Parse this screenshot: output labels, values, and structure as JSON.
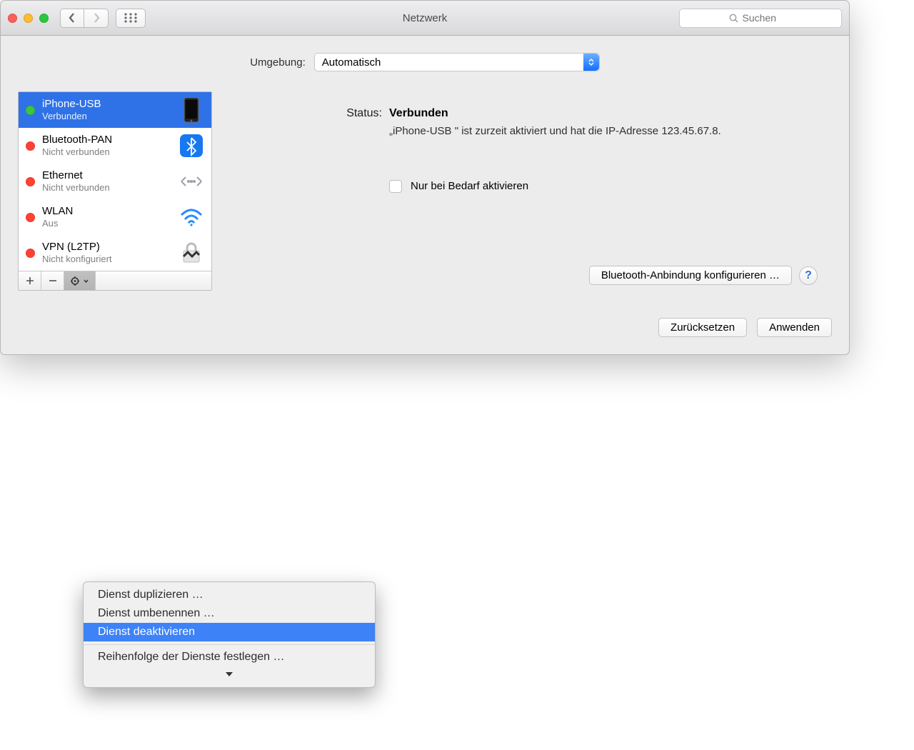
{
  "window": {
    "title": "Netzwerk"
  },
  "search": {
    "placeholder": "Suchen"
  },
  "location": {
    "label": "Umgebung:",
    "value": "Automatisch"
  },
  "services": [
    {
      "name": "iPhone-USB",
      "sub": "Verbunden",
      "status": "green",
      "icon": "iphone",
      "selected": true
    },
    {
      "name": "Bluetooth-PAN",
      "sub": "Nicht verbunden",
      "status": "red",
      "icon": "bluetooth"
    },
    {
      "name": "Ethernet",
      "sub": "Nicht verbunden",
      "status": "red",
      "icon": "ethernet"
    },
    {
      "name": "WLAN",
      "sub": "Aus",
      "status": "red",
      "icon": "wifi"
    },
    {
      "name": "VPN (L2TP)",
      "sub": "Nicht konfiguriert",
      "status": "red",
      "icon": "vpn"
    }
  ],
  "detail": {
    "status_label": "Status:",
    "status_value": "Verbunden",
    "status_desc": "„iPhone-USB \" ist zurzeit aktiviert und hat die IP-Adresse 123.45.67.8.",
    "on_demand_label": "Nur bei Bedarf aktivieren",
    "configure_btn": "Bluetooth-Anbindung konfigurieren …"
  },
  "footer": {
    "revert": "Zurücksetzen",
    "apply": "Anwenden"
  },
  "menu": {
    "duplicate": "Dienst duplizieren …",
    "rename": "Dienst umbenennen …",
    "deactivate": "Dienst deaktivieren",
    "order": "Reihenfolge der Dienste festlegen …"
  }
}
